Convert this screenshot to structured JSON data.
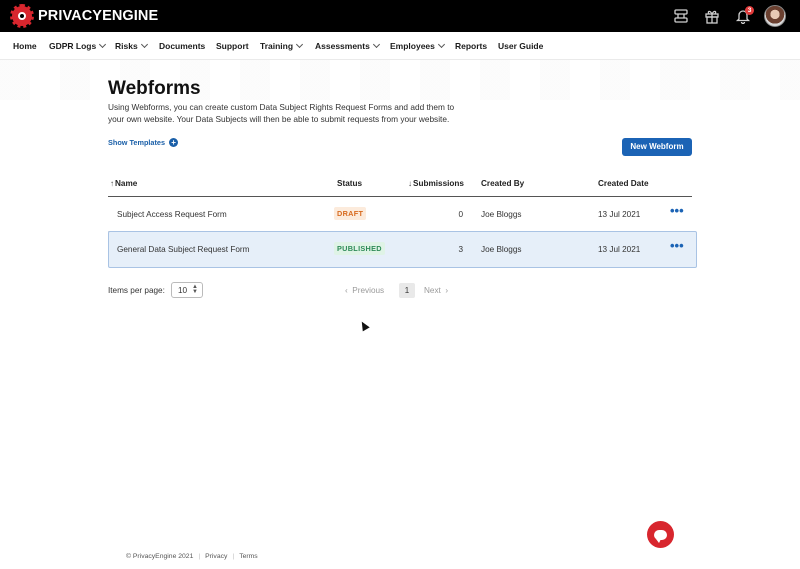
{
  "brand": {
    "name": "PRIVACYENGINE"
  },
  "topbar": {
    "icons": [
      "settings-sliders-icon",
      "gift-icon",
      "bell-icon",
      "avatar"
    ],
    "notification_count": "3"
  },
  "nav": {
    "items": [
      {
        "label": "Home",
        "has_dropdown": false
      },
      {
        "label": "GDPR Logs",
        "has_dropdown": true
      },
      {
        "label": "Risks",
        "has_dropdown": true
      },
      {
        "label": "Documents",
        "has_dropdown": false
      },
      {
        "label": "Support",
        "has_dropdown": false
      },
      {
        "label": "Training",
        "has_dropdown": true
      },
      {
        "label": "Assessments",
        "has_dropdown": true
      },
      {
        "label": "Employees",
        "has_dropdown": true
      },
      {
        "label": "Reports",
        "has_dropdown": false
      },
      {
        "label": "User Guide",
        "has_dropdown": false
      }
    ]
  },
  "page": {
    "title": "Webforms",
    "intro": "Using Webforms, you can create custom Data Subject Rights Request Forms and add them to your own website.  Your Data Subjects will then be able to submit requests from your website.",
    "show_templates": "Show Templates",
    "new_button": "New Webform"
  },
  "table": {
    "columns": {
      "name": "Name",
      "status": "Status",
      "submissions": "Submissions",
      "created_by": "Created By",
      "created_date": "Created Date"
    },
    "rows": [
      {
        "name": "Subject Access Request Form",
        "status": "DRAFT",
        "submissions": "0",
        "created_by": "Joe Bloggs",
        "created_date": "13 Jul 2021",
        "actions": "•••"
      },
      {
        "name": "General Data Subject Request Form",
        "status": "PUBLISHED",
        "submissions": "3",
        "created_by": "Joe Bloggs",
        "created_date": "13 Jul 2021",
        "actions": "•••"
      }
    ]
  },
  "pagination": {
    "items_per_page_label": "Items per page:",
    "items_per_page_value": "10",
    "previous": "Previous",
    "current_page": "1",
    "next": "Next"
  },
  "footer": {
    "copyright": "© PrivacyEngine 2021",
    "privacy": "Privacy",
    "terms": "Terms"
  },
  "colors": {
    "accent": "#1b63b5",
    "brand_red": "#d8262e",
    "draft": "#d76a1e",
    "published": "#2e8b57",
    "selected_row": "#e6eff9"
  }
}
